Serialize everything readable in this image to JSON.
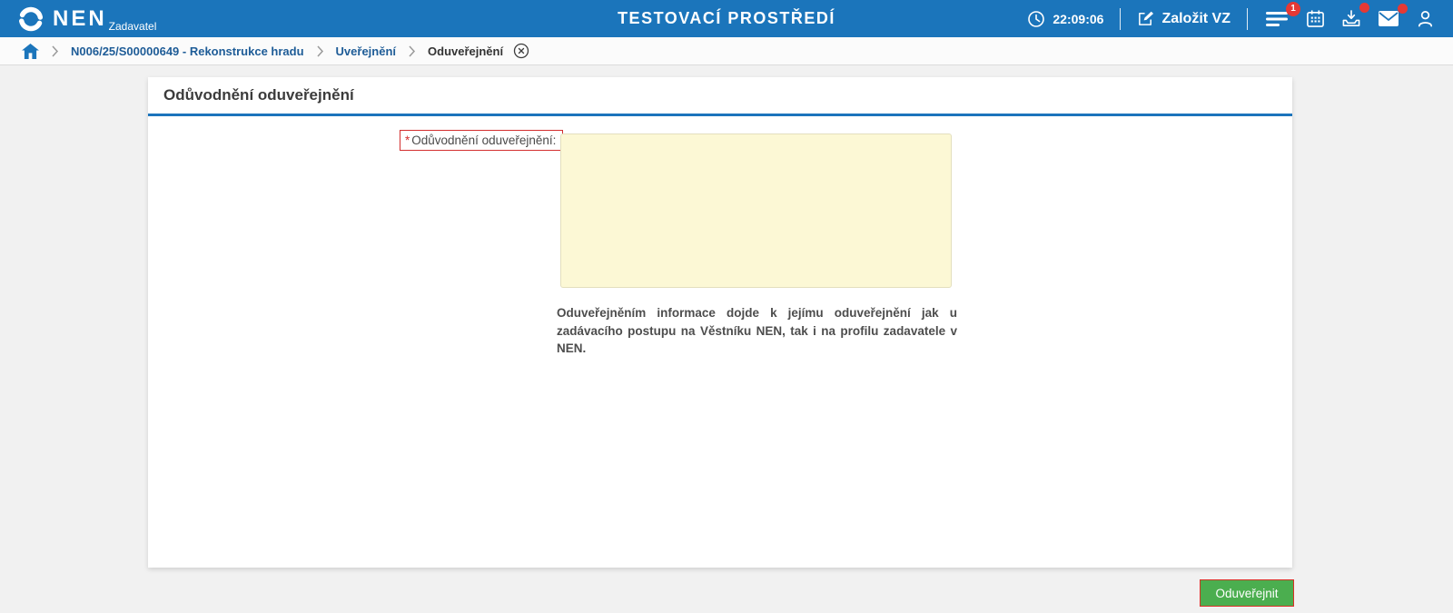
{
  "header": {
    "brand": "NEN",
    "brand_subtitle": "Zadavatel",
    "environment_title": "TESTOVACÍ PROSTŘEDÍ",
    "clock_time": "22:09:06",
    "create_vz_label": "Založit VZ",
    "menu_badge_count": "1",
    "icons": {
      "logo": "nen-swirl",
      "clock": "clock",
      "create": "pencil-square",
      "menu": "hamburger",
      "calendar": "calendar",
      "downloads": "inbox-arrow-down",
      "messages": "envelope",
      "user": "person"
    }
  },
  "breadcrumb": {
    "home_icon": "house",
    "items": [
      {
        "label": "N006/25/S00000649 - Rekonstrukce hradu"
      },
      {
        "label": "Uveřejnění"
      },
      {
        "label": "Oduveřejnění"
      }
    ],
    "close_icon": "circle-x"
  },
  "main": {
    "section_title": "Odůvodnění oduveřejnění",
    "form": {
      "required_mark": "*",
      "label": "Odůvodnění oduveřejnění:",
      "textarea_value": "",
      "help_text": "Oduveřejněním informace dojde k jejímu oduveřejnění jak u zadávacího postupu na Věstníku NEN, tak i na profilu zadavatele v NEN."
    },
    "submit_label": "Oduveřejnit"
  },
  "colors": {
    "header_blue": "#1b75bb",
    "accent_blue": "#1c74bc",
    "breadcrumb_link_blue": "#1e5c97",
    "badge_red": "#e53935",
    "required_red": "#d32f2f",
    "textarea_yellow": "#fcf8d5",
    "button_green": "#4bae4f",
    "page_gray": "#f1f1f1"
  }
}
